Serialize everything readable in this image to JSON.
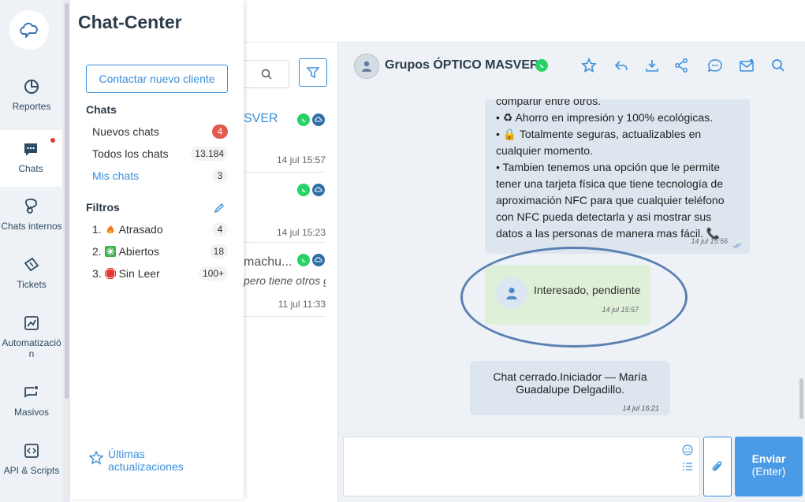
{
  "rail": {
    "items": [
      {
        "label": "Reportes",
        "icon": "pie-chart-icon"
      },
      {
        "label": "Chats",
        "icon": "chat-bubble-icon",
        "active": true
      },
      {
        "label": "Chats internos",
        "icon": "internal-chat-icon"
      },
      {
        "label": "Tickets",
        "icon": "ticket-icon"
      },
      {
        "label": "Automatizació n",
        "icon": "automation-icon"
      },
      {
        "label": "Masivos",
        "icon": "bulk-message-icon"
      },
      {
        "label": "API & Scripts",
        "icon": "code-icon"
      }
    ]
  },
  "chat_center": {
    "title": "Chat-Center",
    "contact_button": "Contactar nuevo cliente",
    "chats_heading": "Chats",
    "chats": [
      {
        "label": "Nuevos chats",
        "count": "4"
      },
      {
        "label": "Todos los chats",
        "count": "13.184"
      },
      {
        "label": "Mis chats",
        "count": "3"
      }
    ],
    "filters_heading": "Filtros",
    "filters": [
      {
        "label": "1. ",
        "name": "Atrasado",
        "count": "4",
        "icon": "fire-icon"
      },
      {
        "label": "2. ",
        "name": "Abiertos",
        "count": "18",
        "icon": "sparkle-icon"
      },
      {
        "label": "3. ",
        "name": "Sin Leer",
        "count": "100+",
        "icon": "stop-sign-icon"
      }
    ],
    "updates_label": "Últimas actualizaciones"
  },
  "chat_list": {
    "items": [
      {
        "name": "SVER",
        "time": "14 jul 15:57",
        "preview": ""
      },
      {
        "name": "",
        "time": "14 jul 15:23",
        "preview": ""
      },
      {
        "name": "machu...",
        "time": "11 jul 11:33",
        "preview": "pero tiene otros g"
      }
    ]
  },
  "conversation": {
    "title": "Grupos ÓPTICO MASVER",
    "message_lines": [
      "compartir entre otros.",
      "•  ♻ Ahorro en impresión y 100% ecológicas.",
      "•  🔒 Totalmente seguras, actualizables en",
      "cualquier momento.",
      "•  Tambien tenemos una opción que le permite",
      "tener una tarjeta física que tiene tecnología de",
      "aproximación NFC para que cualquier teléfono",
      "con NFC pueda detectarla y asi mostrar sus",
      "datos a las personas de manera mas fácil. 📞"
    ],
    "message_time": "14 jul 15:56",
    "note_text": "Interesado, pendiente",
    "note_time": "14 jul 15:57",
    "closed_text": "Chat cerrado.Iniciador — María Guadalupe Delgadillo.",
    "closed_time": "14 jul 16:21"
  },
  "composer": {
    "send_label": "Enviar",
    "send_hint": "(Enter)"
  },
  "colors": {
    "accent": "#3a8fdc",
    "whatsapp": "#25d366",
    "note_bg": "#dff0d8",
    "badge_red": "#e05a50"
  }
}
